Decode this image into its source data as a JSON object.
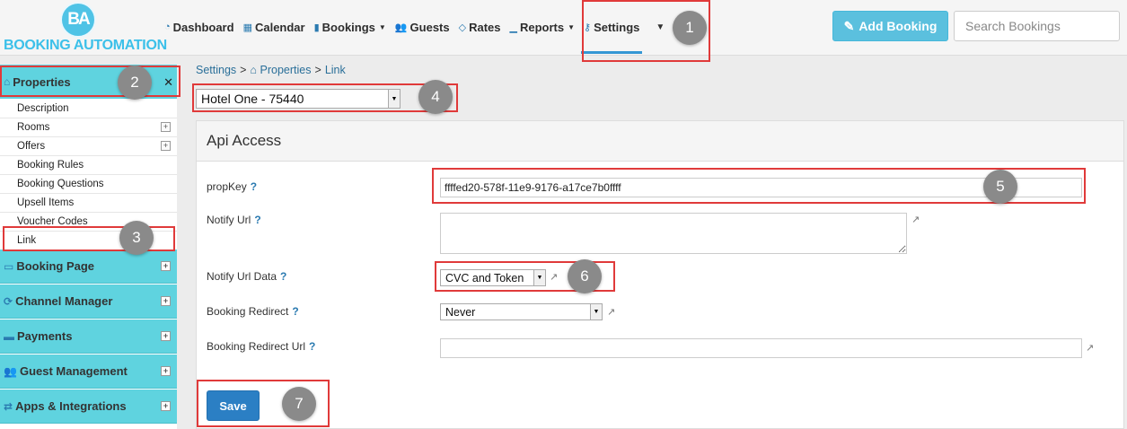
{
  "logo": {
    "mark": "BA",
    "text": "BOOKING AUTOMATION"
  },
  "nav": {
    "items": [
      {
        "icon": "dashboard-icon",
        "glyph": "◔",
        "label": "Dashboard"
      },
      {
        "icon": "calendar-icon",
        "glyph": "▦",
        "label": "Calendar"
      },
      {
        "icon": "bookings-icon",
        "glyph": "▮",
        "label": "Bookings",
        "dropdown": true
      },
      {
        "icon": "guests-icon",
        "glyph": "👥",
        "label": "Guests"
      },
      {
        "icon": "tag-icon",
        "glyph": "◇",
        "label": "Rates"
      },
      {
        "icon": "reports-icon",
        "glyph": "▁",
        "label": "Reports",
        "dropdown": true
      },
      {
        "icon": "key-icon",
        "glyph": "⚷",
        "label": "Settings",
        "active": true
      }
    ],
    "add_booking": "Add Booking",
    "search_placeholder": "Search Bookings"
  },
  "sidebar": {
    "header": "Properties",
    "sub_items": [
      {
        "label": "Description",
        "expandable": false
      },
      {
        "label": "Rooms",
        "expandable": true
      },
      {
        "label": "Offers",
        "expandable": true
      },
      {
        "label": "Booking Rules",
        "expandable": false
      },
      {
        "label": "Booking Questions",
        "expandable": false
      },
      {
        "label": "Upsell Items",
        "expandable": false
      },
      {
        "label": "Voucher Codes",
        "expandable": false
      },
      {
        "label": "Link",
        "expandable": false
      }
    ],
    "sections": [
      {
        "label": "Booking Page",
        "icon": "monitor-icon",
        "glyph": "▭"
      },
      {
        "label": "Channel Manager",
        "icon": "sync-icon",
        "glyph": "⟳"
      },
      {
        "label": "Payments",
        "icon": "credit-card-icon",
        "glyph": "▬"
      },
      {
        "label": "Guest Management",
        "icon": "guests-icon",
        "glyph": "👥"
      },
      {
        "label": "Apps & Integrations",
        "icon": "exchange-icon",
        "glyph": "⇄"
      }
    ]
  },
  "breadcrumb": {
    "settings": "Settings",
    "properties": "Properties",
    "current": "Link",
    "sep": ">"
  },
  "property_select": {
    "value": "Hotel One - 75440"
  },
  "panel": {
    "title": "Api Access",
    "prop_key": {
      "label": "propKey",
      "value": "ffffed20-578f-11e9-9176-a17ce7b0ffff"
    },
    "notify_url": {
      "label": "Notify Url",
      "value": ""
    },
    "notify_url_data": {
      "label": "Notify Url Data",
      "value": "CVC and Token"
    },
    "booking_redirect": {
      "label": "Booking Redirect",
      "value": "Never"
    },
    "booking_redirect_url": {
      "label": "Booking Redirect Url",
      "value": ""
    },
    "save": "Save"
  },
  "annotations": [
    "1",
    "2",
    "3",
    "4",
    "5",
    "6",
    "7"
  ]
}
